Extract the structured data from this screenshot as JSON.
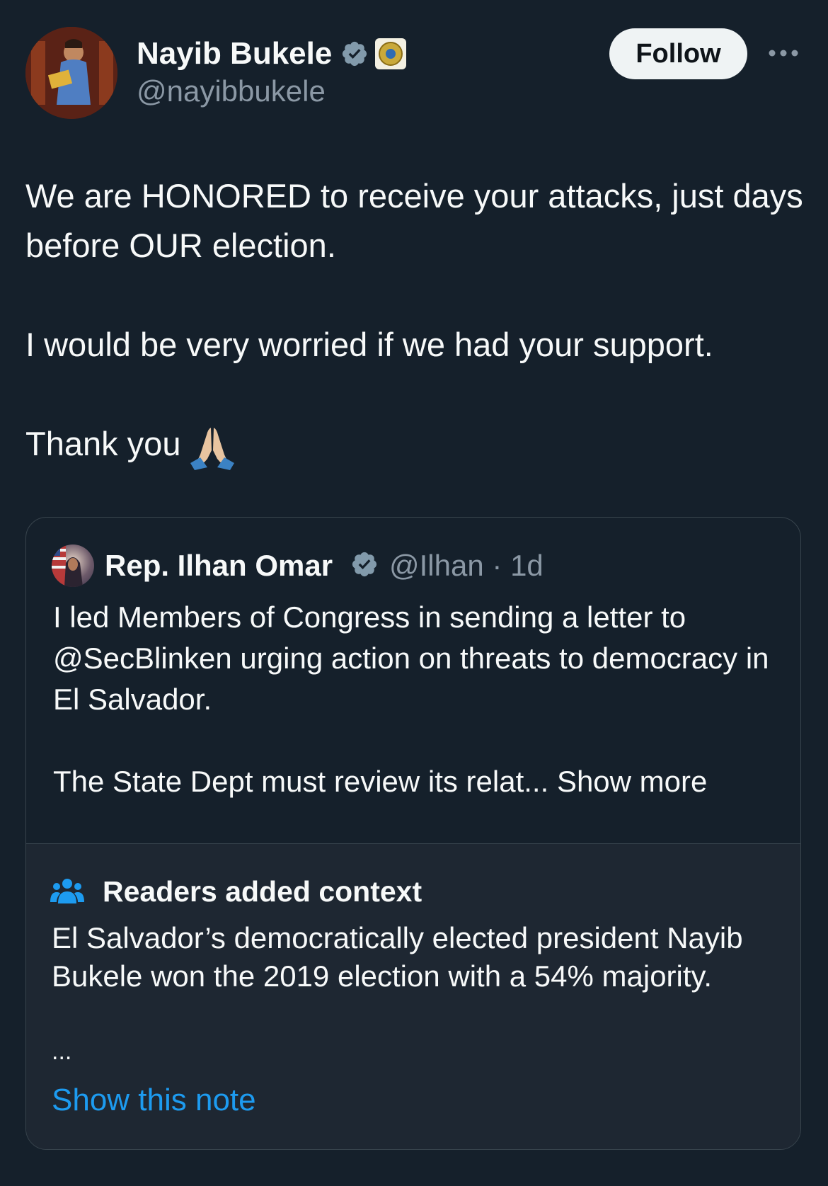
{
  "author": {
    "name": "Nayib Bukele",
    "handle": "@nayibbukele",
    "verified_icon": "verified-badge-icon",
    "affiliation_icon": "el-salvador-seal-icon"
  },
  "follow_label": "Follow",
  "more_icon": "more-options-icon",
  "tweet": {
    "line1": "We are HONORED to receive your attacks, just days before OUR election.",
    "line2": "I would be very worried if we had your support.",
    "line3": "Thank you",
    "emoji": "folded-hands-icon"
  },
  "quoted": {
    "name": "Rep. Ilhan Omar",
    "handle": "@Ilhan",
    "separator": "·",
    "time": "1d",
    "text1": "I led Members of Congress in sending a letter to @SecBlinken urging action on threats to democracy in El Salvador.",
    "text2": "The State Dept must review its relat...",
    "show_more": "Show more"
  },
  "context": {
    "title": "Readers added context",
    "text": "El Salvador’s democratically elected president Nayib Bukele won the 2019 election with a 54% majority.",
    "ellipsis": "...",
    "link": "Show this note"
  },
  "colors": {
    "background": "#15202b",
    "link": "#1d9bf0",
    "secondary_text": "#8b98a5",
    "context_bg": "#1e2732"
  }
}
